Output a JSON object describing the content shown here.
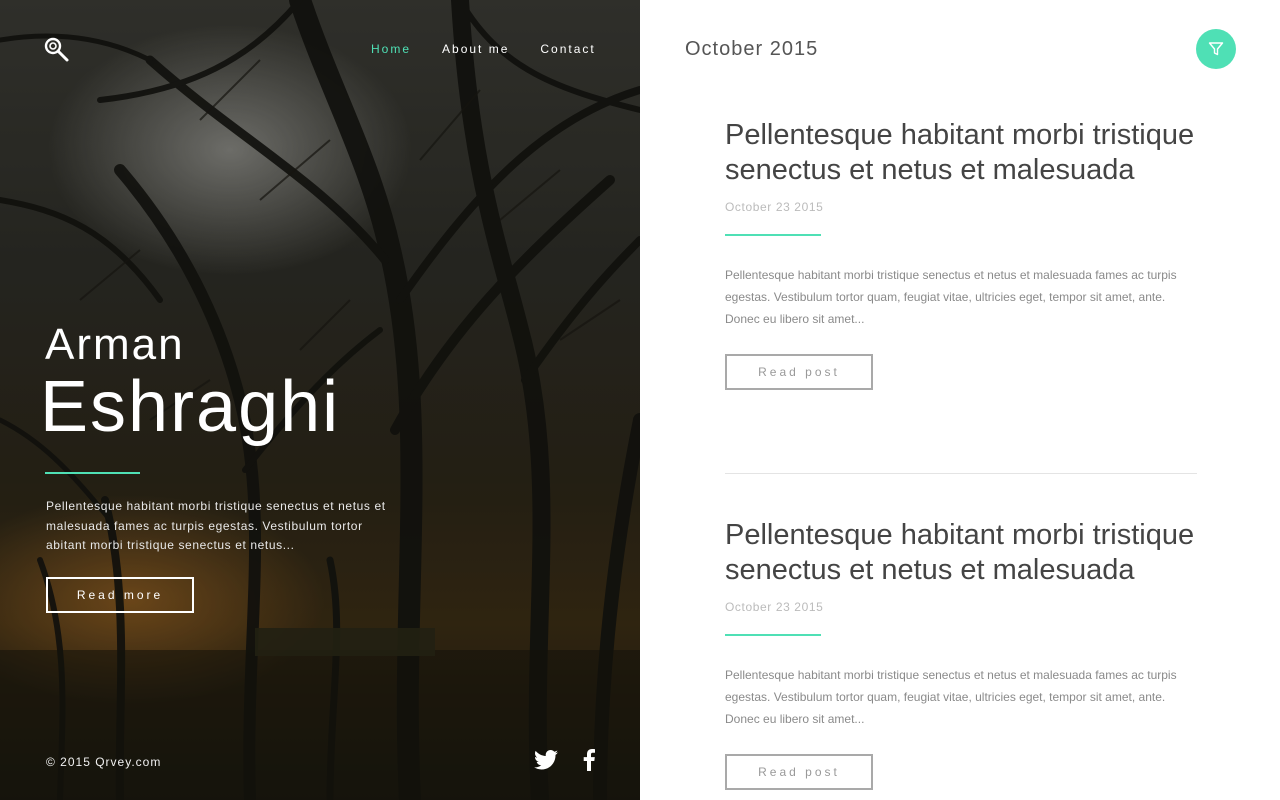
{
  "nav": {
    "items": [
      {
        "label": "Home",
        "active": true
      },
      {
        "label": "About me",
        "active": false
      },
      {
        "label": "Contact",
        "active": false
      }
    ],
    "logo_icon": "magnifier-logo-icon"
  },
  "hero": {
    "first_name": "Arman",
    "last_name": "Eshraghi",
    "description": "Pellentesque habitant morbi tristique senectus et netus et malesuada fames ac turpis egestas. Vestibulum tortor abitant morbi tristique senectus et netus...",
    "button_label": "Read more",
    "copyright": "© 2015 Qrvey.com",
    "social_icons": [
      "twitter-icon",
      "facebook-icon"
    ]
  },
  "content": {
    "month": "October 2015",
    "filter_icon": "filter-icon",
    "posts": [
      {
        "title": "Pellentesque habitant morbi tristique senectus et netus et malesuada",
        "date": "October 23 2015",
        "excerpt": "Pellentesque habitant morbi tristique senectus et netus et malesuada fames ac turpis egestas. Vestibulum tortor quam, feugiat vitae, ultricies eget, tempor sit amet, ante. Donec eu libero sit amet...",
        "button_label": "Read post"
      },
      {
        "title": "Pellentesque habitant morbi tristique senectus et netus et malesuada",
        "date": "October 23 2015",
        "excerpt": "Pellentesque habitant morbi tristique senectus et netus et malesuada fames ac turpis egestas. Vestibulum tortor quam, feugiat vitae, ultricies eget, tempor sit amet, ante. Donec eu libero sit amet...",
        "button_label": "Read post"
      }
    ]
  },
  "colors": {
    "accent": "#4fe0b5",
    "text_dark": "#444444",
    "text_muted": "#8a8a8a"
  }
}
